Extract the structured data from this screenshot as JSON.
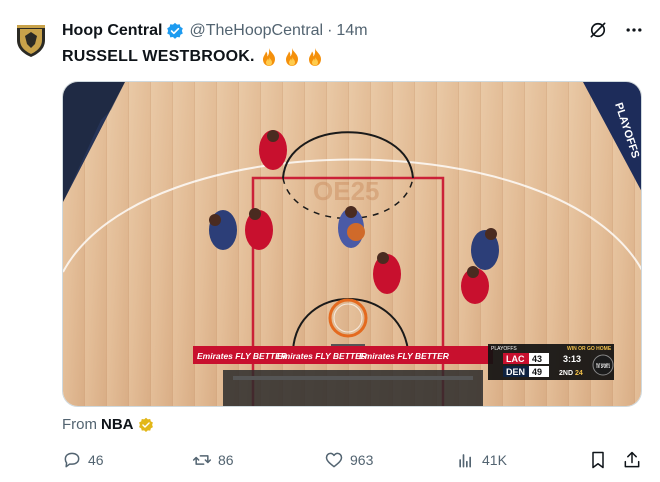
{
  "author": {
    "name": "Hoop Central",
    "handle": "@TheHoopCentral",
    "separator": "·",
    "time": "14m"
  },
  "tweet": {
    "text": "RUSSELL WESTBROOK."
  },
  "media": {
    "banner_text": "Emirates FLY BETTER",
    "playoffs_text": "PLAYOFFS",
    "broadcast_tag": "WIN OR GO HOME",
    "network": "TNT SPORTS",
    "scoreboard": {
      "teams": [
        {
          "abbr": "LAC",
          "score": "43"
        },
        {
          "abbr": "DEN",
          "score": "49"
        }
      ],
      "clock": "3:13",
      "period": "2ND",
      "shot_clock": "24"
    }
  },
  "source": {
    "prefix": "From",
    "name": "NBA"
  },
  "actions": {
    "replies": "46",
    "reposts": "86",
    "likes": "963",
    "views": "41K"
  },
  "colors": {
    "accent_blue": "#1d9bf0",
    "gold_badge": "#e2b719",
    "muted": "#536471"
  }
}
